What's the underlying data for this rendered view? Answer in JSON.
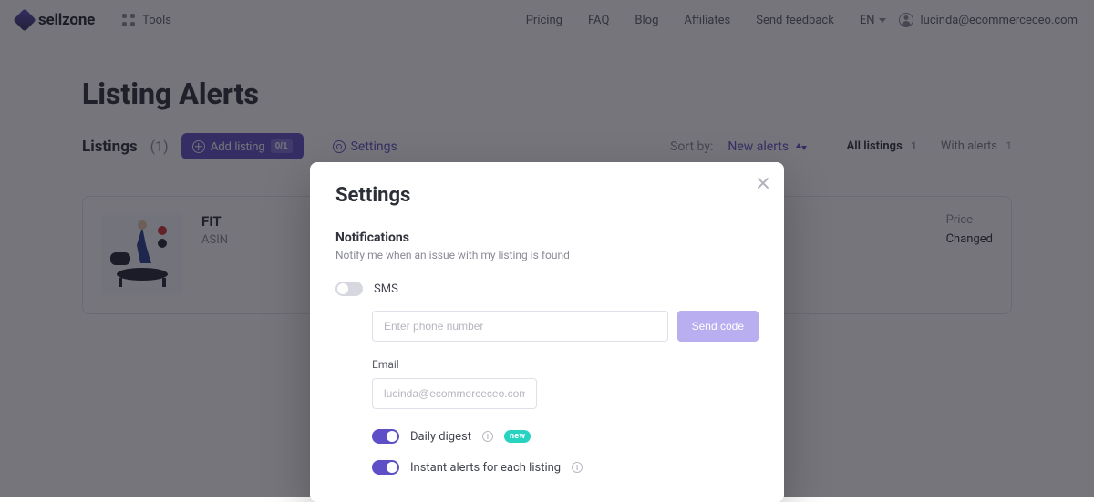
{
  "nav": {
    "brand": "sellzone",
    "tools": "Tools",
    "links": {
      "pricing": "Pricing",
      "faq": "FAQ",
      "blog": "Blog",
      "affiliates": "Affiliates",
      "feedback": "Send feedback"
    },
    "lang": "EN",
    "user_email": "lucinda@ecommerceceo.com"
  },
  "page": {
    "title": "Listing Alerts",
    "listings_label": "Listings",
    "listings_count": "(1)",
    "add_listing_label": "Add listing",
    "add_listing_badge": "0/1",
    "settings_link": "Settings",
    "sort_label": "Sort by:",
    "sort_value": "New alerts",
    "filters": {
      "all": {
        "label": "All listings",
        "count": "1"
      },
      "with": {
        "label": "With alerts",
        "count": "1"
      }
    }
  },
  "card": {
    "title_fragment": "FIT",
    "asin_fragment": "ASIN",
    "price_header": "Price",
    "price_status": "Changed"
  },
  "modal": {
    "title": "Settings",
    "section_title": "Notifications",
    "section_sub": "Notify me when an issue with my listing is found",
    "sms_label": "SMS",
    "phone_placeholder": "Enter phone number",
    "send_code": "Send code",
    "email_label": "Email",
    "email_placeholder": "lucinda@ecommerceceo.com",
    "daily_digest": "Daily digest",
    "new_badge": "new",
    "instant_alerts": "Instant alerts for each listing"
  }
}
